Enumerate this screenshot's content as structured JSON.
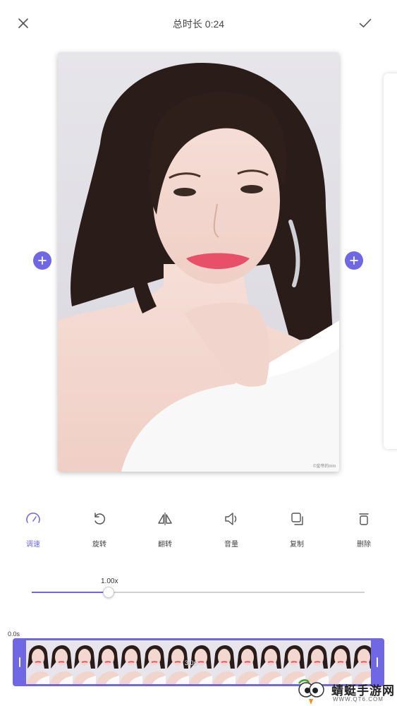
{
  "header": {
    "title": "总时长 0:24",
    "close_icon": "close-icon",
    "confirm_icon": "check-icon"
  },
  "preview": {
    "add_icon": "plus-icon",
    "watermark_small": "©皇帝的mm"
  },
  "toolbar": {
    "items": [
      {
        "label": "调速",
        "icon": "speedometer-icon",
        "active": true
      },
      {
        "label": "旋转",
        "icon": "rotate-icon",
        "active": false
      },
      {
        "label": "翻转",
        "icon": "flip-icon",
        "active": false
      },
      {
        "label": "音量",
        "icon": "volume-icon",
        "active": false
      },
      {
        "label": "复制",
        "icon": "copy-icon",
        "active": false
      },
      {
        "label": "删除",
        "icon": "trash-icon",
        "active": false
      }
    ]
  },
  "speed": {
    "label": "1.00x",
    "fraction": 0.23
  },
  "timeline": {
    "start_label": "0.0s",
    "clip_duration": "3.0s",
    "frame_count": 15
  },
  "watermark": {
    "name": "蜻蜓手游网",
    "url": "WWW.QT6.COM"
  },
  "colors": {
    "accent": "#6f67e3",
    "track": "#d0d0d0"
  }
}
